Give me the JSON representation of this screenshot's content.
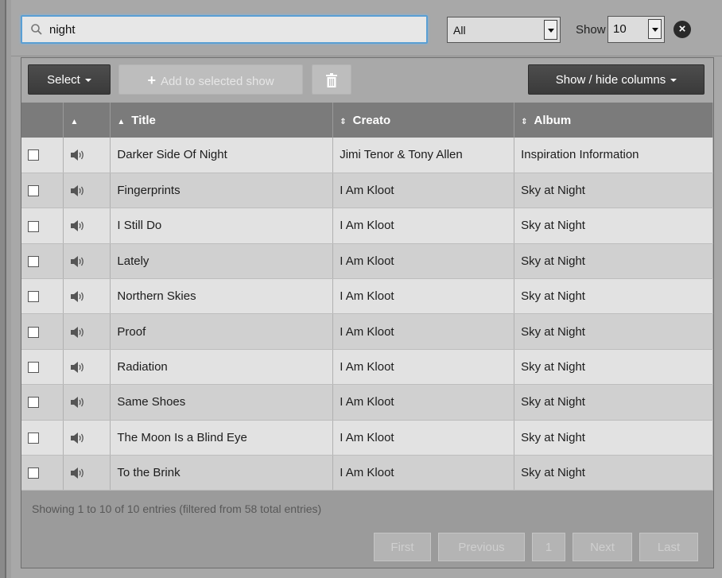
{
  "search": {
    "value": "night",
    "icon": "search-icon"
  },
  "filter": {
    "selected": "All"
  },
  "show": {
    "label": "Show",
    "selected": "10"
  },
  "close_icon": "×",
  "toolbar": {
    "select_label": "Select",
    "add_label": "Add to selected show",
    "delete_icon": "trash-icon",
    "columns_label": "Show / hide columns"
  },
  "columns": {
    "title": "Title",
    "creator": "Creato",
    "album": "Album"
  },
  "rows": [
    {
      "title": "Darker Side Of Night",
      "creator": "Jimi Tenor & Tony Allen",
      "album": "Inspiration Information"
    },
    {
      "title": "Fingerprints",
      "creator": "I Am Kloot",
      "album": "Sky at Night"
    },
    {
      "title": "I Still Do",
      "creator": "I Am Kloot",
      "album": "Sky at Night"
    },
    {
      "title": "Lately",
      "creator": "I Am Kloot",
      "album": "Sky at Night"
    },
    {
      "title": "Northern Skies",
      "creator": "I Am Kloot",
      "album": "Sky at Night"
    },
    {
      "title": "Proof",
      "creator": "I Am Kloot",
      "album": "Sky at Night"
    },
    {
      "title": "Radiation",
      "creator": "I Am Kloot",
      "album": "Sky at Night"
    },
    {
      "title": "Same Shoes",
      "creator": "I Am Kloot",
      "album": "Sky at Night"
    },
    {
      "title": "The Moon Is a Blind Eye",
      "creator": "I Am Kloot",
      "album": "Sky at Night"
    },
    {
      "title": "To the Brink",
      "creator": "I Am Kloot",
      "album": "Sky at Night"
    }
  ],
  "footer": {
    "info": "Showing 1 to 10 of 10 entries (filtered from 58 total entries)",
    "first": "First",
    "previous": "Previous",
    "page": "1",
    "next": "Next",
    "last": "Last"
  },
  "colors": {
    "focus_border": "#5a9fd4",
    "header_bg": "#7b7b7b",
    "dark_button": "#3f3f3f"
  }
}
